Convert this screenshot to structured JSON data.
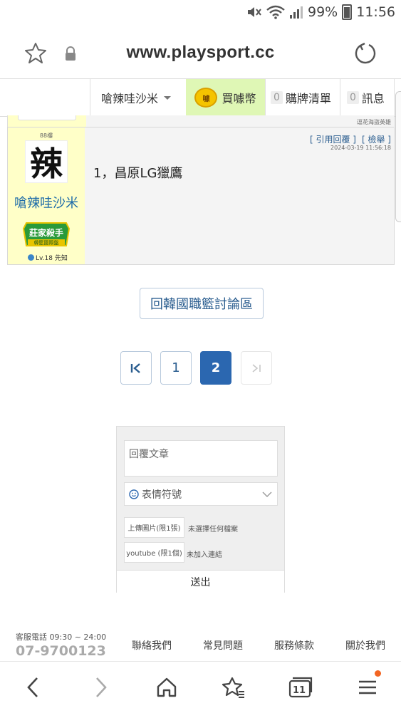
{
  "status_bar": {
    "battery": "99%",
    "time": "11:56"
  },
  "browser": {
    "url": "www.playsport.cc",
    "tab_count": "11"
  },
  "nav": {
    "user": "嗆辣哇沙米",
    "coin": "買噱幣",
    "coin_icon_text": "噱",
    "cart_count": "0",
    "cart": "購牌清單",
    "msg_count": "0",
    "msg": "訊息"
  },
  "post": {
    "prev_note": "逗花海盜英雄",
    "floor": "88樓",
    "avatar_char": "辣",
    "username": "嗆辣哇沙米",
    "badge_line1": "莊家殺手",
    "badge_line2": "韓籃國際盤",
    "level": "Lv.18 先知",
    "quote": "[ 引用回覆 ]",
    "report": "[ 檢舉 ]",
    "timestamp": "2024-03-19 11:56:18",
    "content": "1，昌原LG獵鷹"
  },
  "back_button": "回韓國職籃討論區",
  "pagination": {
    "first": "I<",
    "pages": [
      "1",
      "2"
    ],
    "current": "2",
    "last": ">I"
  },
  "reply_form": {
    "textarea_placeholder": "回覆文章",
    "emoji_label": "表情符號",
    "upload_label": "上傳圖片(限1張)",
    "upload_status": "未選擇任何檔案",
    "youtube_label": "youtube (限1個)",
    "youtube_status": "未加入連結",
    "submit": "送出"
  },
  "footer": {
    "hours": "客服電話 09:30 ~ 24:00",
    "phone": "07-9700123",
    "links": [
      "聯絡我們",
      "常見問題",
      "服務條款",
      "關於我們"
    ]
  },
  "colors": {
    "accent": "#2b67b0",
    "username": "#1c6aa8",
    "coin_bg": "#dff7b5",
    "userpanel_bg": "#ffffc8"
  }
}
